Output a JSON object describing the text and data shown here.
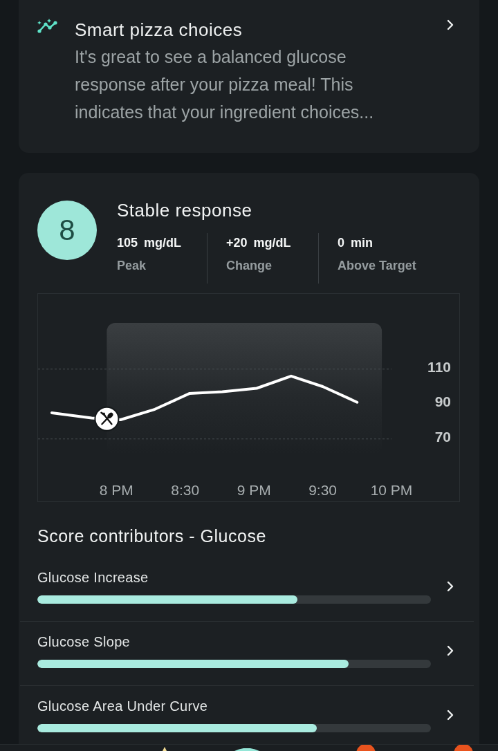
{
  "insight_card": {
    "title": "Smart pizza choices",
    "body": "It's great to see a balanced glucose response after your pizza meal! This indicates that your ingredient choices..."
  },
  "score_card": {
    "score": "8",
    "title": "Stable response",
    "stats": [
      {
        "value": "105",
        "unit": "mg/dL",
        "label": "Peak"
      },
      {
        "value": "+20",
        "unit": "mg/dL",
        "label": "Change"
      },
      {
        "value": "0",
        "unit": "min",
        "label": "Above Target"
      }
    ],
    "chart_data": {
      "type": "line",
      "x": [
        7.53,
        7.82,
        8.03,
        8.28,
        8.53,
        8.77,
        9.02,
        9.27,
        9.5,
        9.75
      ],
      "values": [
        85,
        82,
        81,
        87,
        96,
        97,
        99,
        106,
        100,
        91
      ],
      "xlim": [
        7.43,
        10
      ],
      "ylim": [
        70,
        110
      ],
      "xticks": [
        {
          "value": 8,
          "label": "8 PM"
        },
        {
          "value": 8.5,
          "label": "8:30"
        },
        {
          "value": 9,
          "label": "9 PM"
        },
        {
          "value": 9.5,
          "label": "9:30"
        },
        {
          "value": 10,
          "label": "10 PM"
        }
      ],
      "yticks": [
        70,
        90,
        110
      ],
      "bands": [
        {
          "axis": "x",
          "from": 7.93,
          "to": 9.93
        }
      ],
      "ref_lines": [
        {
          "axis": "y",
          "value": 110
        },
        {
          "axis": "y",
          "value": 70
        }
      ]
    }
  },
  "contributors": {
    "title": "Score contributors - Glucose",
    "items": [
      {
        "label": "Glucose Increase",
        "level": 0.66
      },
      {
        "label": "Glucose Slope",
        "level": 0.79
      },
      {
        "label": "Glucose Area Under Curve",
        "level": 0.71
      }
    ]
  }
}
